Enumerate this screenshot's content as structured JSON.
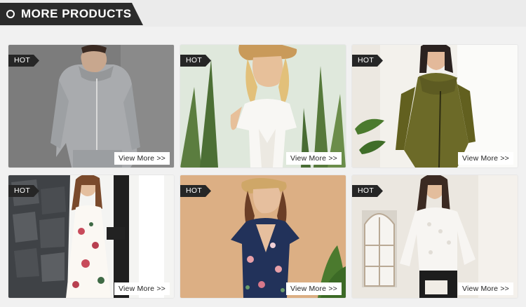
{
  "header": {
    "title": "MORE PRODUCTS"
  },
  "products": [
    {
      "badge": "HOT",
      "cta": "View More >>",
      "image": "man-grey-hoodie-sweatsuit"
    },
    {
      "badge": "HOT",
      "cta": "View More >>",
      "image": "woman-white-top-sun-hat"
    },
    {
      "badge": "HOT",
      "cta": "View More >>",
      "image": "woman-olive-wool-coat"
    },
    {
      "badge": "HOT",
      "cta": "View More >>",
      "image": "woman-floral-white-dress"
    },
    {
      "badge": "HOT",
      "cta": "View More >>",
      "image": "woman-navy-floral-dress-straw-hat"
    },
    {
      "badge": "HOT",
      "cta": "View More >>",
      "image": "woman-white-lace-blouse"
    }
  ],
  "colors": {
    "header": "#2b2b2b",
    "badge": "#262626",
    "background": "#f1f1f1"
  }
}
